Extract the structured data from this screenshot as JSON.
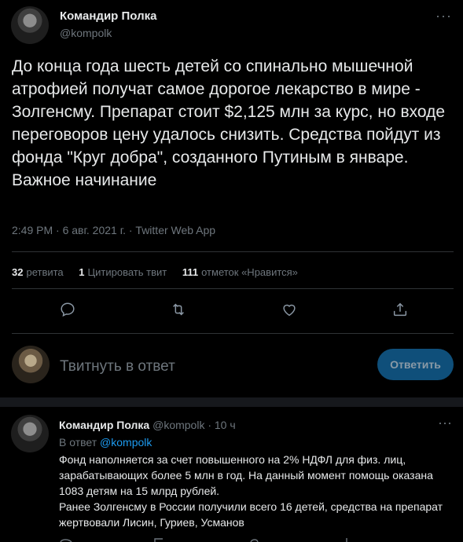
{
  "tweet": {
    "author_name": "Командир Полка",
    "author_handle": "@kompolk",
    "more_icon": "more-icon",
    "text": "До конца года шесть детей со спинально мышечной атрофией получат самое дорогое лекарство в мире - Золгенсму. Препарат стоит $2,125 млн за курс, но входе переговоров цену удалось снизить. Средства пойдут из фонда \"Круг добра\", созданного Путиным в январе.\nВажное начинание",
    "meta": "2:49 PM · 6 авг. 2021 г. · Twitter Web App"
  },
  "stats": {
    "retweets_count": "32",
    "retweets_label": "ретвита",
    "quotes_count": "1",
    "quotes_label": "Цитировать твит",
    "likes_count": "111",
    "likes_label": "отметок «Нравится»"
  },
  "actions": {
    "reply_icon": "reply-icon",
    "retweet_icon": "retweet-icon",
    "like_icon": "like-icon",
    "share_icon": "share-icon"
  },
  "reply_box": {
    "placeholder": "Твитнуть в ответ",
    "button_label": "Ответить"
  },
  "reply_tweet": {
    "author_name": "Командир Полка",
    "author_handle": "@kompolk",
    "time": "· 10 ч",
    "in_reply_prefix": "В ответ",
    "in_reply_handle": "@kompolk",
    "text": "Фонд наполняется за счет повышенного на 2% НДФЛ для физ. лиц, зарабатывающих более 5 млн в год. На данный момент помощь оказана 1083 детям на 15 млрд рублей.\nРанее Золгенсму в России получили всего 16 детей, средства на препарат жертвовали Лисин, Гуриев, Усманов"
  },
  "colors": {
    "background": "#000000",
    "text": "#e7e9ea",
    "secondary": "#6e767d",
    "accent": "#1d9bf0",
    "reply_button": "#0f4f7a"
  }
}
